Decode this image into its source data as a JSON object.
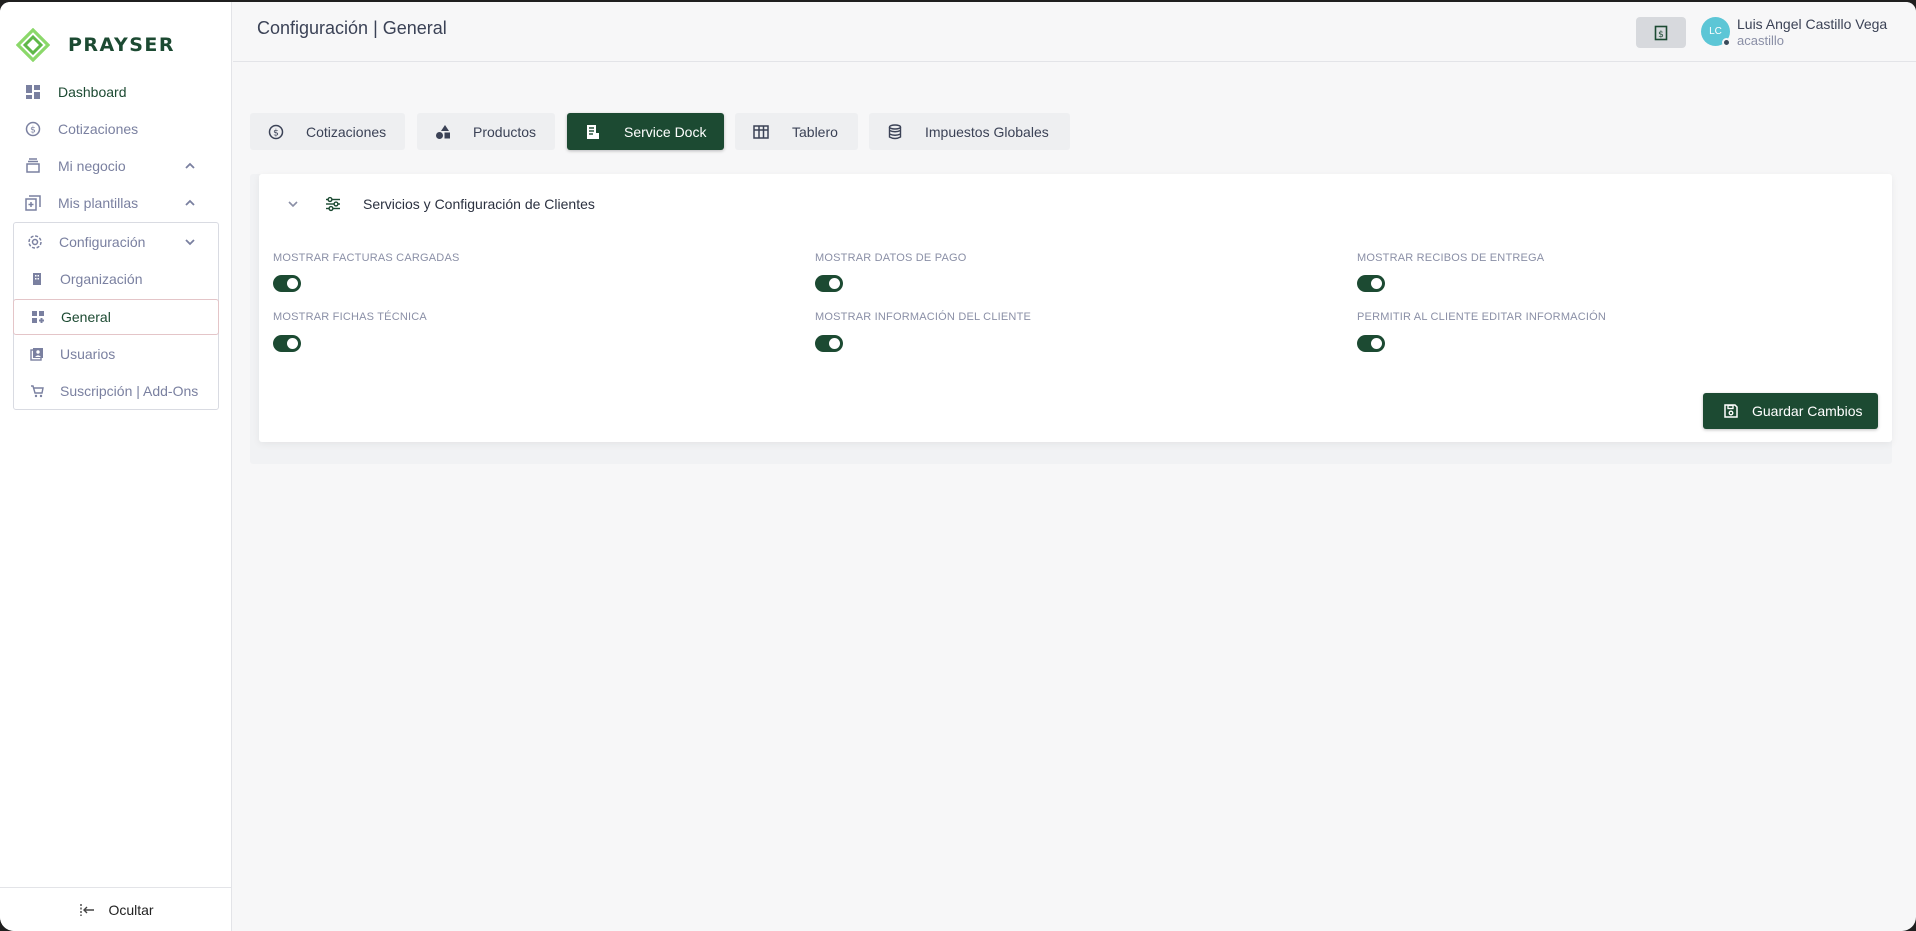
{
  "brand": {
    "name": "PRAYSER",
    "accent": "#1c4a32",
    "logo_color": "#7ed35a"
  },
  "sidebar": {
    "items": [
      {
        "label": "Dashboard",
        "icon": "dashboard-icon"
      },
      {
        "label": "Cotizaciones",
        "icon": "dollar-circle-icon"
      },
      {
        "label": "Mi negocio",
        "icon": "inbox-stack-icon"
      },
      {
        "label": "Mis plantillas",
        "icon": "templates-icon"
      },
      {
        "label": "Configuración",
        "icon": "gear-icon"
      }
    ],
    "config_sub": [
      {
        "label": "Organización",
        "icon": "building-icon"
      },
      {
        "label": "General",
        "icon": "grid-icon"
      },
      {
        "label": "Usuarios",
        "icon": "users-icon"
      },
      {
        "label": "Suscripción | Add-Ons",
        "icon": "cart-icon"
      }
    ],
    "footer_label": "Ocultar"
  },
  "header": {
    "title": "Configuración | General",
    "user": {
      "initials": "LC",
      "name": "Luis Angel Castillo Vega",
      "handle": "acastillo"
    }
  },
  "tabs": [
    {
      "label": "Cotizaciones",
      "icon": "dollar-circle-icon",
      "active": false
    },
    {
      "label": "Productos",
      "icon": "shapes-icon",
      "active": false
    },
    {
      "label": "Service Dock",
      "icon": "document-icon",
      "active": true
    },
    {
      "label": "Tablero",
      "icon": "table-icon",
      "active": false
    },
    {
      "label": "Impuestos Globales",
      "icon": "database-icon",
      "active": false
    }
  ],
  "card": {
    "title": "Servicios y Configuración de Clientes",
    "options": [
      {
        "label": "MOSTRAR FACTURAS CARGADAS",
        "enabled": true
      },
      {
        "label": "MOSTRAR DATOS DE PAGO",
        "enabled": true
      },
      {
        "label": "MOSTRAR RECIBOS DE ENTREGA",
        "enabled": true
      },
      {
        "label": "MOSTRAR FICHAS TÉCNICA",
        "enabled": true
      },
      {
        "label": "MOSTRAR INFORMACIÓN DEL CLIENTE",
        "enabled": true
      },
      {
        "label": "PERMITIR AL CLIENTE EDITAR INFORMACIÓN",
        "enabled": true
      }
    ],
    "save_label": "Guardar Cambios"
  }
}
